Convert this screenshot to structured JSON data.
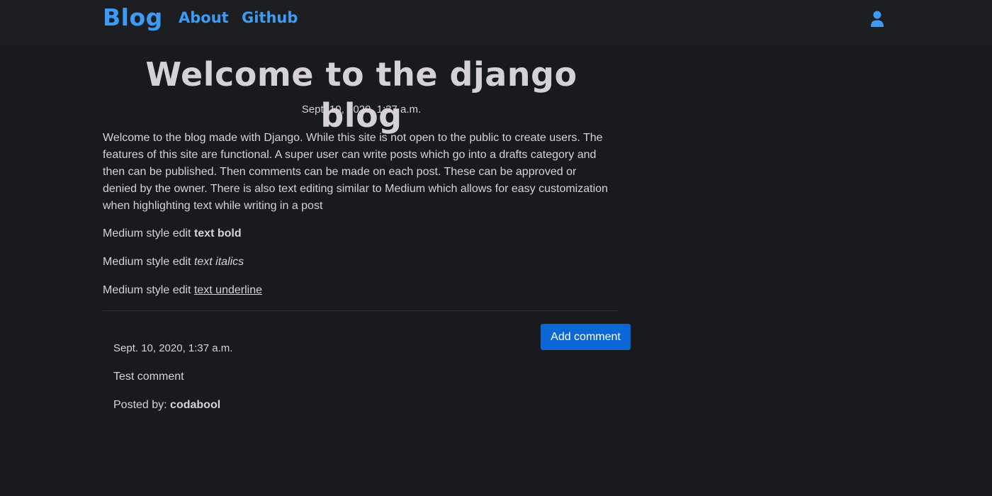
{
  "navbar": {
    "brand": "Blog",
    "links": [
      "About",
      "Github"
    ],
    "user_icon": "user-icon",
    "accent_color": "#3d9bf5"
  },
  "post": {
    "title": "Welcome to the django blog",
    "date": "Sept. 10, 2020, 1:37 a.m.",
    "body": "Welcome to the blog made with Django. While this site is not open to the public to create users. The features of this site are functional. A super user can write posts which go into a drafts category and then can be published. Then comments can be made on each post. These can be approved or denied by the owner. There is also text editing similar to Medium which allows for easy customization when highlighting text while writing in a post",
    "edits": [
      {
        "prefix": "Medium style edit ",
        "styled": "text bold"
      },
      {
        "prefix": "Medium style edit ",
        "styled": "text italics"
      },
      {
        "prefix": "Medium style edit ",
        "styled": "text underline"
      }
    ]
  },
  "comments": {
    "add_button": "Add comment",
    "items": [
      {
        "date": "Sept. 10, 2020, 1:37 a.m.",
        "text": "Test comment",
        "posted_by_label": "Posted by: ",
        "author": "codabool"
      }
    ]
  },
  "colors": {
    "background": "#181a1e",
    "navbar": "#1c1e22",
    "button": "#0b66d6",
    "text": "#d6d3d8"
  }
}
